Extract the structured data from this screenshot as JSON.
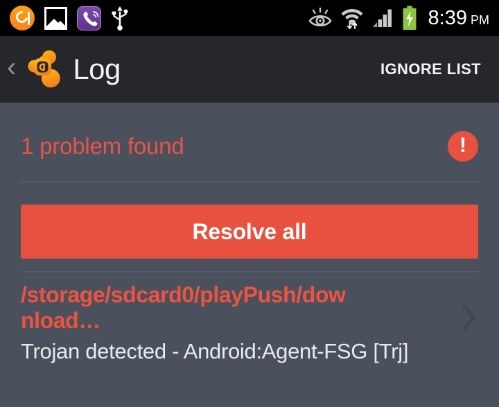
{
  "status_bar": {
    "clock_time": "8:39",
    "clock_ampm": "PM",
    "left_icons": [
      {
        "name": "avast-notification-icon",
        "label": "avast"
      },
      {
        "name": "gallery-photo-icon",
        "label": "Gallery"
      },
      {
        "name": "viber-icon",
        "label": "Viber"
      },
      {
        "name": "usb-icon",
        "label": "USB connected"
      }
    ],
    "right_icons": [
      {
        "name": "smart-stay-eye-icon",
        "label": "Smart stay"
      },
      {
        "name": "wifi-icon",
        "label": "Wi-Fi"
      },
      {
        "name": "cellular-signal-icon",
        "label": "Signal"
      },
      {
        "name": "battery-charging-icon",
        "label": "Charging"
      }
    ]
  },
  "action_bar": {
    "back_glyph": "‹",
    "logo_name": "avast-logo-icon",
    "title": "Log",
    "ignore_list_label": "IGNORE LIST"
  },
  "content": {
    "problem_summary": "1 problem found",
    "alert_glyph": "!",
    "resolve_all_label": "Resolve all",
    "threat": {
      "path": "/storage/sdcard0/playPush/download…",
      "description": "Trojan detected - Android:Agent-FSG [Trj]",
      "chevron_name": "chevron-right-icon"
    }
  },
  "colors": {
    "status_bar_bg": "#000000",
    "action_bar_bg": "#26272c",
    "content_bg": "#4a505c",
    "accent_red": "#e8503f",
    "threat_red": "#ec5442",
    "divider": "#565d69",
    "brand_orange": "#f7941d",
    "battery_green": "#8cc63e",
    "text_primary": "#ffffff"
  }
}
